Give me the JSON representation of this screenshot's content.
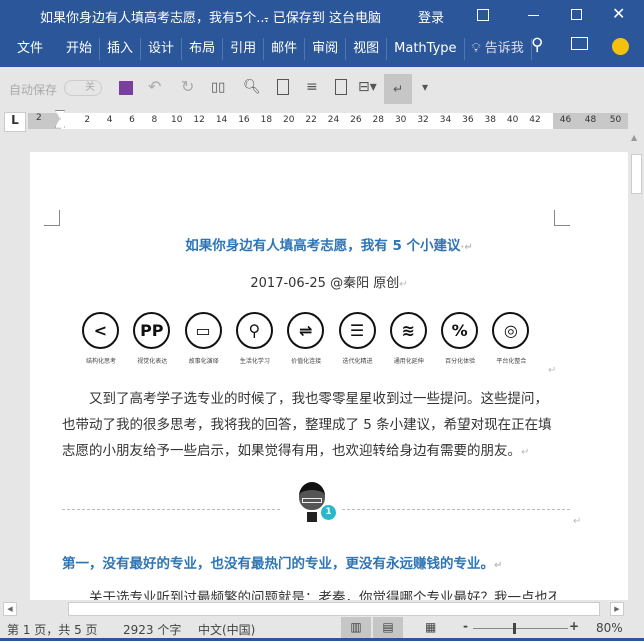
{
  "titlebar": {
    "doc_title": "如果你身边有人填高考志愿，我有5个...",
    "save_status": "-  已保存到 这台电脑",
    "login": "登录"
  },
  "ribbon": {
    "tabs": [
      "文件",
      "开始",
      "插入",
      "设计",
      "布局",
      "引用",
      "邮件",
      "审阅",
      "视图",
      "MathType"
    ],
    "tell_me": "告诉我"
  },
  "qat": {
    "autosave_label": "自动保存",
    "autosave_state": "关"
  },
  "ruler": {
    "left_ticks": [
      "2"
    ],
    "ticks": [
      "2",
      "4",
      "6",
      "8",
      "10",
      "12",
      "14",
      "16",
      "18",
      "20",
      "22",
      "24",
      "26",
      "28",
      "30",
      "32",
      "34",
      "36",
      "38",
      "40",
      "42"
    ],
    "right_ticks": [
      "46",
      "48",
      "50"
    ],
    "tab_selector": "L"
  },
  "document": {
    "title": "如果你身边有人填高考志愿，我有 5 个小建议",
    "meta": "2017-06-25 @秦阳 原创",
    "icons": [
      {
        "icon": "share-icon",
        "label": "结构化思考"
      },
      {
        "icon": "eyes-icon",
        "label": "视觉化表达"
      },
      {
        "icon": "speech-bubble-icon",
        "label": "故事化演绎"
      },
      {
        "icon": "magnifier-icon",
        "label": "生活化学习"
      },
      {
        "icon": "exchange-arrows-icon",
        "label": "价值化连接"
      },
      {
        "icon": "ladder-icon",
        "label": "迭代化精进"
      },
      {
        "icon": "spring-icon",
        "label": "通用化延伸"
      },
      {
        "icon": "percent-icon",
        "label": "百分化体验"
      },
      {
        "icon": "target-icon",
        "label": "平台化整合"
      }
    ],
    "intro": "又到了高考学子选专业的时候了，我也零零星星收到过一些提问。这些提问，也带动了我的很多思考，我将我的回答，整理成了 5 条小建议，希望对现在正在填志愿的小朋友给予一些启示，如果觉得有用，也欢迎转给身边有需要的朋友。",
    "badge_number": "1",
    "heading1": "第一，没有最好的专业，也没有最热门的专业，更没有永远赚钱的专业。",
    "para2": "关于选专业听到过最频繁的问题就是：老秦，你觉得哪个专业最好？我一点也不挑",
    "accent": "#2e75b6"
  },
  "status": {
    "page": "第 1 页，共 5 页",
    "words": "2923 个字",
    "language": "中文(中国)",
    "zoom": "80%",
    "zoom_minus": "-",
    "zoom_plus": "+"
  }
}
